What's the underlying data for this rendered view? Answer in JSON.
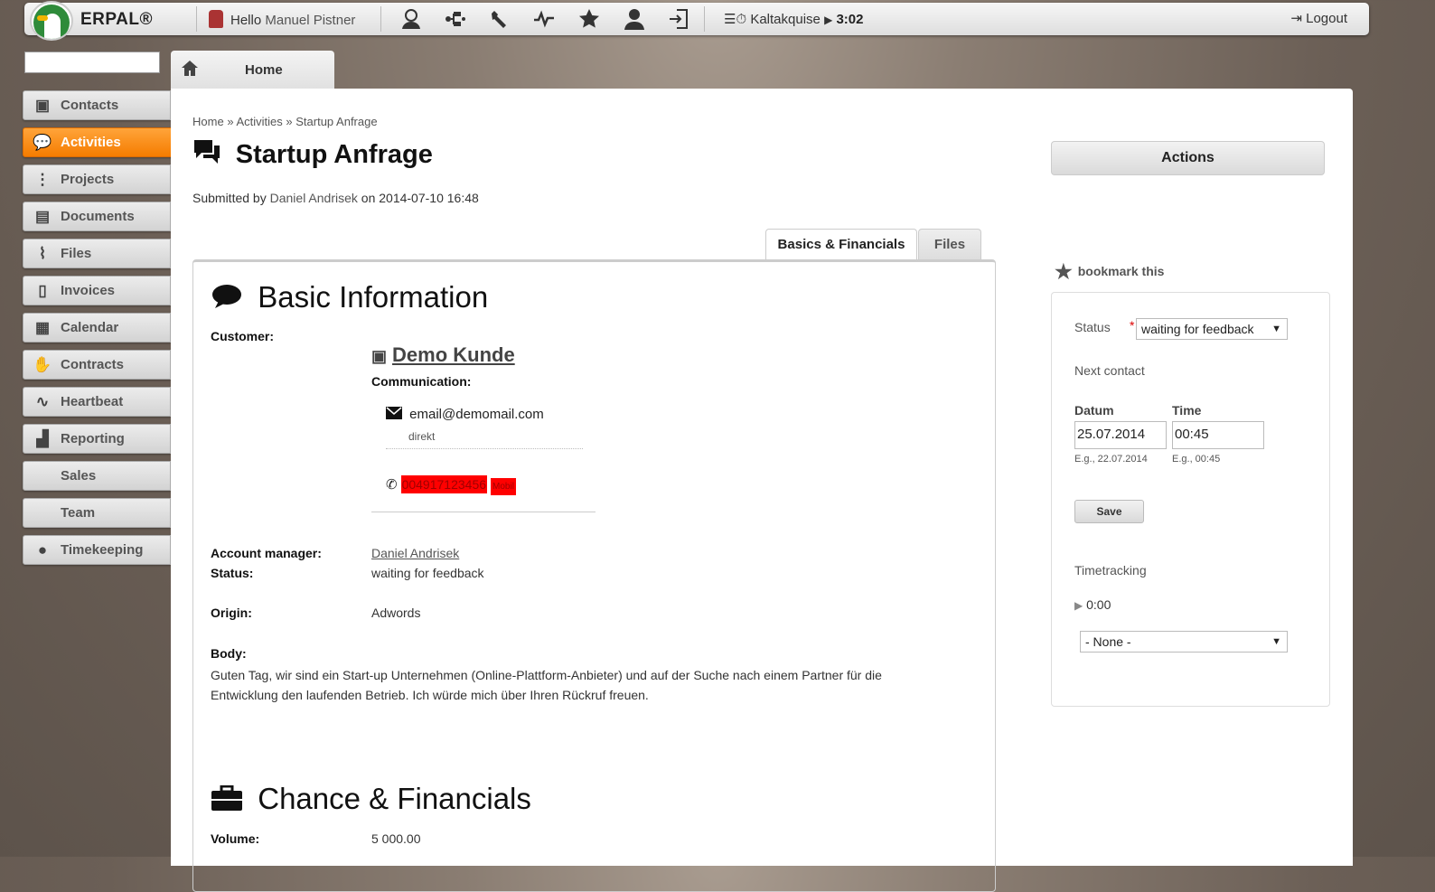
{
  "topbar": {
    "brand": "ERPAL®",
    "hello_prefix": "Hello",
    "user_name": "Manuel Pistner",
    "timer_label": "Kaltakquise",
    "timer_value": "3:02",
    "logout": "Logout"
  },
  "home_tab": {
    "label": "Home"
  },
  "search": {
    "value": ""
  },
  "sidebar": {
    "items": [
      {
        "label": "Contacts",
        "icon": "contacts-icon"
      },
      {
        "label": "Activities",
        "icon": "activities-icon"
      },
      {
        "label": "Projects",
        "icon": "projects-icon"
      },
      {
        "label": "Documents",
        "icon": "documents-icon"
      },
      {
        "label": "Files",
        "icon": "paperclip-icon"
      },
      {
        "label": "Invoices",
        "icon": "invoice-icon"
      },
      {
        "label": "Calendar",
        "icon": "calendar-icon"
      },
      {
        "label": "Contracts",
        "icon": "handshake-icon"
      },
      {
        "label": "Heartbeat",
        "icon": "heartbeat-icon"
      },
      {
        "label": "Reporting",
        "icon": "bar-chart-icon"
      },
      {
        "label": "Sales",
        "icon": ""
      },
      {
        "label": "Team",
        "icon": ""
      },
      {
        "label": "Timekeeping",
        "icon": "user-icon"
      }
    ],
    "active": "Activities"
  },
  "main": {
    "breadcrumb": [
      "Home",
      "Activities",
      "Startup Anfrage"
    ],
    "title": "Startup Anfrage",
    "submitted_prefix": "Submitted by",
    "submitted_by": "Daniel Andrisek",
    "submitted_on_prefix": "on",
    "submitted_on": "2014-07-10 16:48",
    "actions_label": "Actions",
    "tabs": [
      {
        "label": "Basics & Financials",
        "active": true
      },
      {
        "label": "Files",
        "active": false
      }
    ],
    "basic": {
      "heading": "Basic Information",
      "customer_label": "Customer:",
      "customer_name": "Demo Kunde",
      "communication_label": "Communication:",
      "email": "email@demomail.com",
      "email_type": "direkt",
      "phone": "004917123456",
      "phone_type": "Mobil",
      "account_manager_label": "Account manager:",
      "account_manager": "Daniel Andrisek",
      "status_label": "Status:",
      "status": "waiting for feedback",
      "origin_label": "Origin:",
      "origin": "Adwords",
      "body_label": "Body:",
      "body": "Guten Tag, wir sind ein Start-up Unternehmen (Online-Plattform-Anbieter) und auf der Suche nach einem Partner für die Entwicklung den laufenden Betrieb. Ich würde mich über Ihren Rückruf freuen."
    },
    "financial": {
      "heading": "Chance & Financials",
      "volume_label": "Volume:",
      "volume": "5 000.00"
    }
  },
  "right": {
    "bookmark": "bookmark this",
    "status_label": "Status",
    "required_mark": "*",
    "status_value": "waiting for feedback",
    "next_contact_label": "Next contact",
    "datum_label": "Datum",
    "datum_value": "25.07.2014",
    "datum_hint": "E.g., 22.07.2014",
    "time_label": "Time",
    "time_value": "00:45",
    "time_hint": "E.g., 00:45",
    "save_label": "Save",
    "timetracking_label": "Timetracking",
    "timetracking_value": "0:00",
    "timetracking_select": "- None -"
  }
}
